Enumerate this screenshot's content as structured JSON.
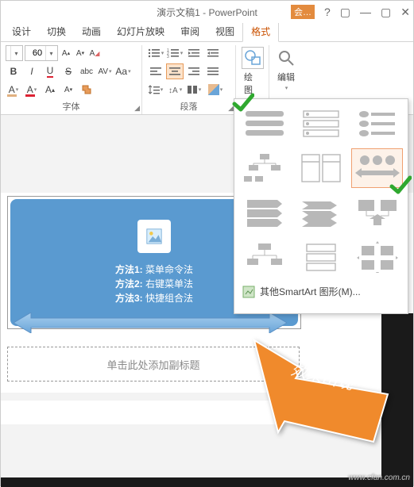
{
  "titlebar": {
    "title": "演示文稿1 - PowerPoint",
    "meeting": "会…",
    "help": "?",
    "restore": "▢",
    "minimize": "—",
    "close": "✕"
  },
  "tabs": [
    {
      "label": "设计"
    },
    {
      "label": "切换"
    },
    {
      "label": "动画"
    },
    {
      "label": "幻灯片放映"
    },
    {
      "label": "审阅"
    },
    {
      "label": "视图"
    },
    {
      "label": "格式",
      "active": true
    }
  ],
  "ribbon": {
    "font": {
      "size": "60",
      "labels": {
        "B": "B",
        "I": "I",
        "U": "U",
        "S": "S",
        "av": "AV",
        "aa": "Aa",
        "big": "A",
        "small": "A",
        "clear": "A▸"
      },
      "group": "字体"
    },
    "para": {
      "group": "段落"
    },
    "draw": {
      "group": "绘图"
    },
    "edit": {
      "group": "编辑"
    }
  },
  "slide": {
    "lines": [
      {
        "k": "方法1:",
        "v": "菜单命令法"
      },
      {
        "k": "方法2:",
        "v": "右键菜单法"
      },
      {
        "k": "方法3:",
        "v": "快捷组合法"
      }
    ],
    "subtitle": "单击此处添加副标题"
  },
  "flyout": {
    "more": "其他SmartArt 图形(M)..."
  },
  "callout": {
    "text": "效果出现"
  },
  "watermark": "www.cfan.com.cn"
}
